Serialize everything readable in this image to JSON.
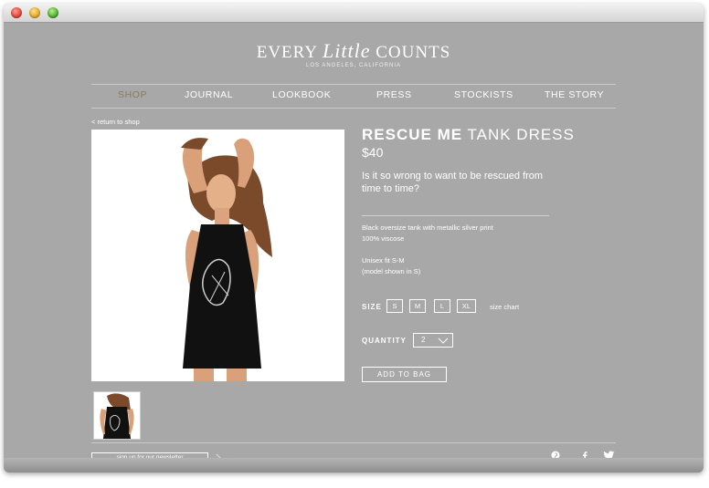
{
  "brand": {
    "logo_left": "EVERY ",
    "logo_script": "Little",
    "logo_right": " COUNTS",
    "tagline": "LOS ANGELES, CALIFORNIA"
  },
  "nav": [
    "SHOP",
    "JOURNAL",
    "LOOKBOOK",
    "PRESS",
    "STOCKISTS",
    "THE STORY"
  ],
  "nav_active": "SHOP",
  "back_link": "< return to shop",
  "product": {
    "title_bold": "RESCUE ME",
    "title_rest": " TANK DRESS",
    "price": "$40",
    "tagline": "Is it so wrong to want to be rescued from time to time?",
    "desc_line1": "Black oversize tank with metallic silver print",
    "desc_line2": "100% viscose",
    "desc_line3": "Unisex fit S-M",
    "desc_line4": "(model shown in S)"
  },
  "size": {
    "label": "SIZE",
    "options": [
      "S",
      "M",
      "L",
      "XL"
    ],
    "chart_link": "size chart"
  },
  "quantity": {
    "label": "QUANTITY",
    "value": "2"
  },
  "add_to_bag": "ADD TO BAG",
  "footer": {
    "newsletter": "sign up for our newsletter"
  },
  "icons": [
    "pinterest-icon",
    "facebook-icon",
    "twitter-icon",
    "chevron-down-icon",
    "chevron-right-icon"
  ],
  "colors": {
    "background": "#a8a8a8",
    "active_nav": "#8a7a5a",
    "text": "#ffffff"
  }
}
